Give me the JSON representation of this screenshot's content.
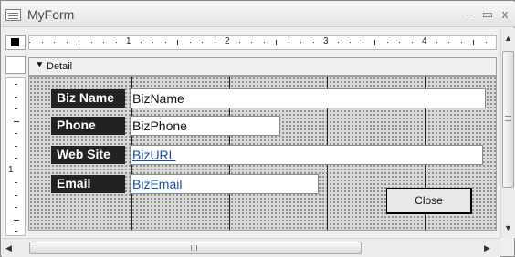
{
  "window": {
    "title": "MyForm",
    "minimize_glyph": "–",
    "restore_glyph": "▭",
    "close_glyph": "x"
  },
  "ruler": {
    "numbers": [
      "1",
      "2",
      "3",
      "4"
    ]
  },
  "section": {
    "label": "Detail",
    "arrow_glyph": "⯆"
  },
  "vertical_ruler": {
    "number": "1"
  },
  "fields": [
    {
      "label": "Biz Name",
      "value": "BizName"
    },
    {
      "label": "Phone",
      "value": "BizPhone"
    },
    {
      "label": "Web Site",
      "value": "BizURL"
    },
    {
      "label": "Email",
      "value": "BizEmail"
    }
  ],
  "close_button": {
    "label": "Close"
  },
  "scroll": {
    "up_glyph": "▲",
    "down_glyph": "▼",
    "left_glyph": "◀",
    "right_glyph": "▶"
  },
  "colors": {
    "label_bg": "#222222",
    "label_text": "#ffffff",
    "link": "#1a4d9e",
    "grid_bg": "#d8d8d8"
  },
  "icons": {
    "form_icon": "form-view-icon",
    "section_arrow": "section-collapse-icon"
  }
}
